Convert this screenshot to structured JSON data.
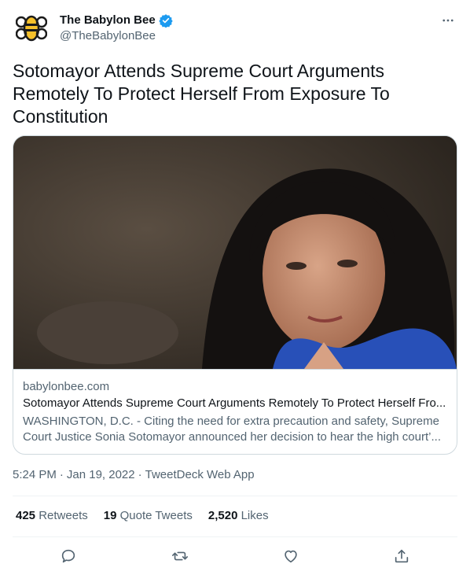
{
  "account": {
    "display_name": "The Babylon Bee",
    "handle": "@TheBabylonBee",
    "verified": true
  },
  "tweet": {
    "text": "Sotomayor Attends Supreme Court Arguments Remotely To Protect Herself From Exposure To Constitution"
  },
  "card": {
    "domain": "babylonbee.com",
    "title": "Sotomayor Attends Supreme Court Arguments Remotely To Protect Herself Fro...",
    "description": "WASHINGTON, D.C. - Citing the need for extra precaution and safety, Supreme Court Justice Sonia Sotomayor announced her decision to hear the high court’..."
  },
  "meta": {
    "time": "5:24 PM",
    "date": "Jan 19, 2022",
    "source": "TweetDeck Web App"
  },
  "stats": {
    "retweets_count": "425",
    "retweets_label": "Retweets",
    "quotes_count": "19",
    "quotes_label": "Quote Tweets",
    "likes_count": "2,520",
    "likes_label": "Likes"
  },
  "icons": {
    "avatar": "bee-logo-icon",
    "verified": "verified-badge-icon",
    "more": "more-icon",
    "reply": "reply-icon",
    "retweet": "retweet-icon",
    "like": "heart-icon",
    "share": "share-icon"
  },
  "colors": {
    "verified_blue": "#1d9bf0",
    "secondary_text": "#536471",
    "border": "#cfd9de",
    "bee_yellow": "#f6c12b"
  }
}
